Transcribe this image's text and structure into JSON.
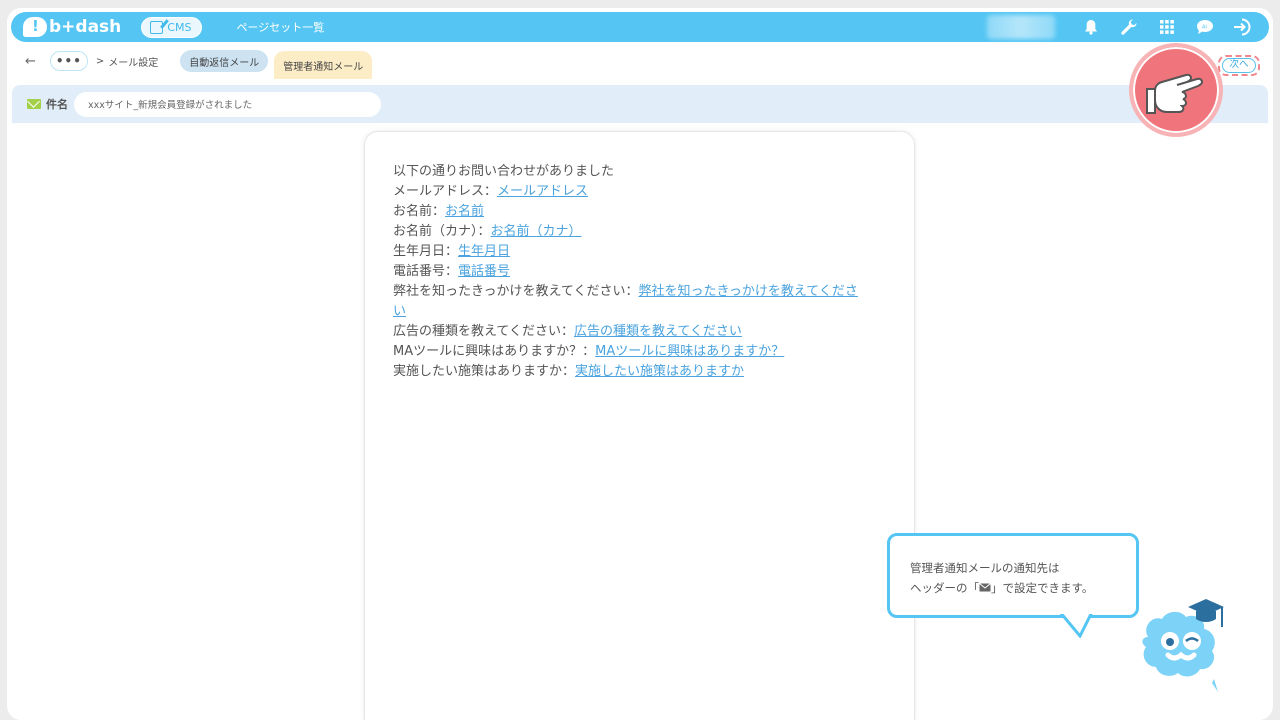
{
  "header": {
    "logo_text": "b+dash",
    "cms_label": "CMS",
    "nav_link": "ページセット一覧",
    "icons": [
      "bell-icon",
      "wrench-icon",
      "grid-icon",
      "chat-icon",
      "logout-icon"
    ]
  },
  "breadcrumb": {
    "back": "←",
    "more": "•••",
    "separator": ">",
    "current": "メール設定"
  },
  "tabs": {
    "auto_reply": "自動返信メール",
    "admin_notify": "管理者通知メール"
  },
  "next_button": "次へ",
  "subject": {
    "label": "件名",
    "value": "xxxサイト_新規会員登録がされました"
  },
  "mail_body": {
    "intro": "以下の通りお問い合わせがありました",
    "fields": [
      {
        "label": "メールアドレス：",
        "tag": "メールアドレス"
      },
      {
        "label": "お名前：",
        "tag": "お名前"
      },
      {
        "label": "お名前（カナ）：",
        "tag": "お名前（カナ）"
      },
      {
        "label": "生年月日：",
        "tag": "生年月日"
      },
      {
        "label": "電話番号：",
        "tag": "電話番号"
      },
      {
        "label": "弊社を知ったきっかけを教えてください：",
        "tag": "弊社を知ったきっかけを教えてくださ"
      },
      {
        "label": "",
        "tag": "い"
      },
      {
        "label": "広告の種類を教えてください：",
        "tag": "広告の種類を教えてください"
      },
      {
        "label": "MAツールに興味はありますか？：",
        "tag": "MAツールに興味はありますか？"
      },
      {
        "label": "実施したい施策はありますか：",
        "tag": "実施したい施策はありますか"
      }
    ]
  },
  "tooltip": {
    "line1": "管理者通知メールの通知先は",
    "line2_pre": "ヘッダーの「",
    "line2_post": "」で設定できます。"
  },
  "colors": {
    "primary": "#55c6f3",
    "highlight": "#f0747c",
    "link": "#4aa3df",
    "chip_admin": "#fcedc6",
    "chip_auto": "#cde3f2"
  }
}
